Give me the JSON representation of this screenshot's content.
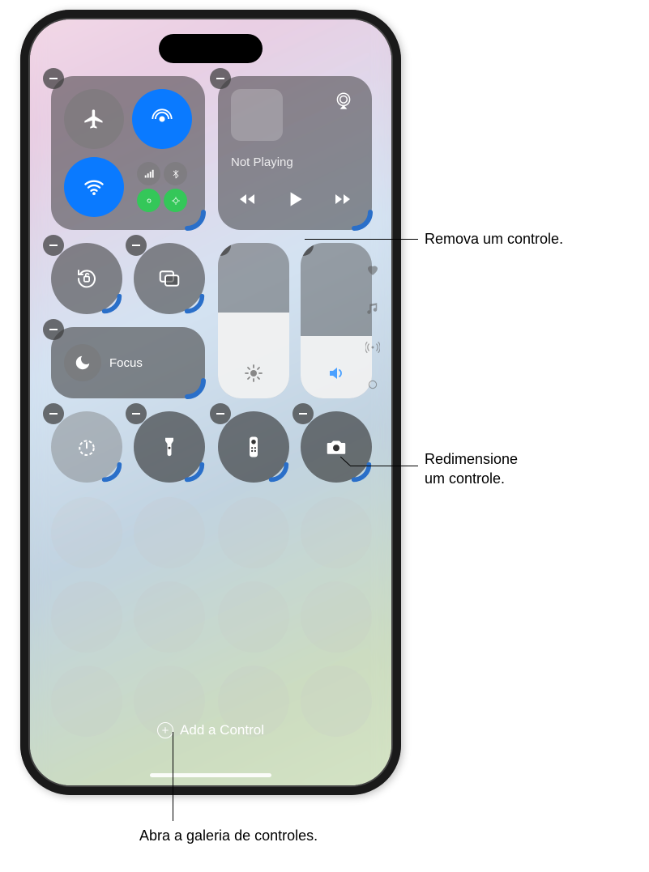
{
  "callouts": {
    "remove": "Remova um controle.",
    "resize_line1": "Redimensione",
    "resize_line2": "um controle.",
    "gallery": "Abra a galeria de controles."
  },
  "media": {
    "now_playing": "Not Playing"
  },
  "focus": {
    "label": "Focus"
  },
  "add_control": {
    "label": "Add a Control"
  },
  "sliders": {
    "brightness_pct": 55,
    "volume_pct": 40
  },
  "icons": {
    "airplane": "airplane-icon",
    "airdrop": "airdrop-icon",
    "wifi": "wifi-icon",
    "cellular": "cellular-bars-icon",
    "bluetooth": "bluetooth-icon",
    "hotspot": "personal-hotspot-icon",
    "satellite": "satellite-icon",
    "airplay": "airplay-icon",
    "rewind": "rewind-icon",
    "play": "play-icon",
    "ffwd": "fast-forward-icon",
    "orientation_lock": "orientation-lock-icon",
    "screen_mirroring": "screen-mirroring-icon",
    "brightness": "sun-icon",
    "volume": "speaker-icon",
    "moon": "moon-icon",
    "timer": "timer-icon",
    "flashlight": "flashlight-icon",
    "remote": "apple-tv-remote-icon",
    "camera": "camera-icon",
    "heart": "heart-icon",
    "music_note": "music-note-icon",
    "antenna": "antenna-icon",
    "circle": "circle-icon"
  }
}
